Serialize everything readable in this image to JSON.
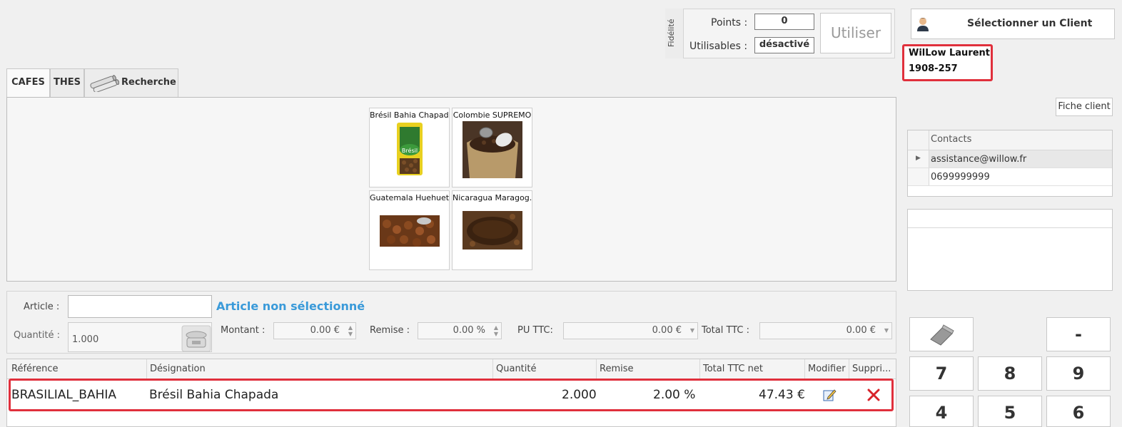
{
  "fidelity": {
    "tab_label": "Fidélité",
    "points_label": "Points :",
    "points_value": "0",
    "usable_label": "Utilisables :",
    "usable_value": "désactivé",
    "use_button": "Utiliser"
  },
  "client": {
    "select_button": "Sélectionner un Client",
    "name": "WilLow Laurent",
    "code": "1908-257",
    "fiche_button": "Fiche client",
    "contacts_header": "Contacts",
    "contacts": [
      "assistance@willow.fr",
      "0699999999"
    ]
  },
  "tabs": [
    "CAFES",
    "THES",
    "Recherche"
  ],
  "products": [
    {
      "name": "Brésil Bahia Chapada"
    },
    {
      "name": "Colombie SUPREMO"
    },
    {
      "name": "Guatemala Huehuet..."
    },
    {
      "name": "Nicaragua Maragog..."
    }
  ],
  "article": {
    "article_label": "Article :",
    "not_selected": "Article non sélectionné",
    "quantity_label": "Quantité :",
    "quantity_value": "1.000",
    "montant_label": "Montant :",
    "montant_value": "0.00 €",
    "remise_label": "Remise :",
    "remise_value": "0.00 %",
    "pu_label": "PU TTC:",
    "pu_value": "0.00 €",
    "total_label": "Total TTC :",
    "total_value": "0.00 €"
  },
  "grid": {
    "headers": [
      "Référence",
      "Désignation",
      "Quantité",
      "Remise",
      "Total TTC net",
      "Modifier",
      "Suppri..."
    ],
    "rows": [
      {
        "reference": "BRASILIAL_BAHIA",
        "designation": "Brésil Bahia Chapada",
        "quantite": "2.000",
        "remise": "2.00 %",
        "total": "47.43 €"
      }
    ]
  },
  "keypad": [
    "-",
    "7",
    "8",
    "9",
    "4",
    "5",
    "6"
  ]
}
